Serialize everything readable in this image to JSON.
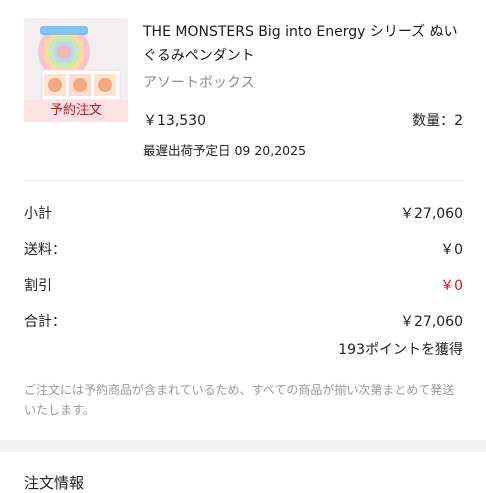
{
  "product": {
    "title": "THE MONSTERS Big into Energy シリーズ ぬいぐるみペンダント",
    "variant": "アソートボックス",
    "price": "￥13,530",
    "quantity": "数量：2",
    "latest_ship_date": "最遅出荷予定日 09 20,2025",
    "badge": "予約注文",
    "thumbnail_icon": "product-box-image"
  },
  "summary": {
    "subtotal_label": "小計",
    "subtotal_value": "￥27,060",
    "shipping_label": "送料：",
    "shipping_value": "￥0",
    "discount_label": "割引",
    "discount_value": "￥0",
    "total_label": "合計：",
    "total_value": "￥27,060",
    "points": "193ポイントを獲得"
  },
  "note": "ご注文には予約商品が含まれているため、すべての商品が揃い次第まとめて発送いたします。",
  "section": {
    "title": "注文情報"
  },
  "colors": {
    "accent_red": "#d0121f",
    "badge_bg": "#fbe2e4",
    "muted_text": "#9a9a9a"
  }
}
